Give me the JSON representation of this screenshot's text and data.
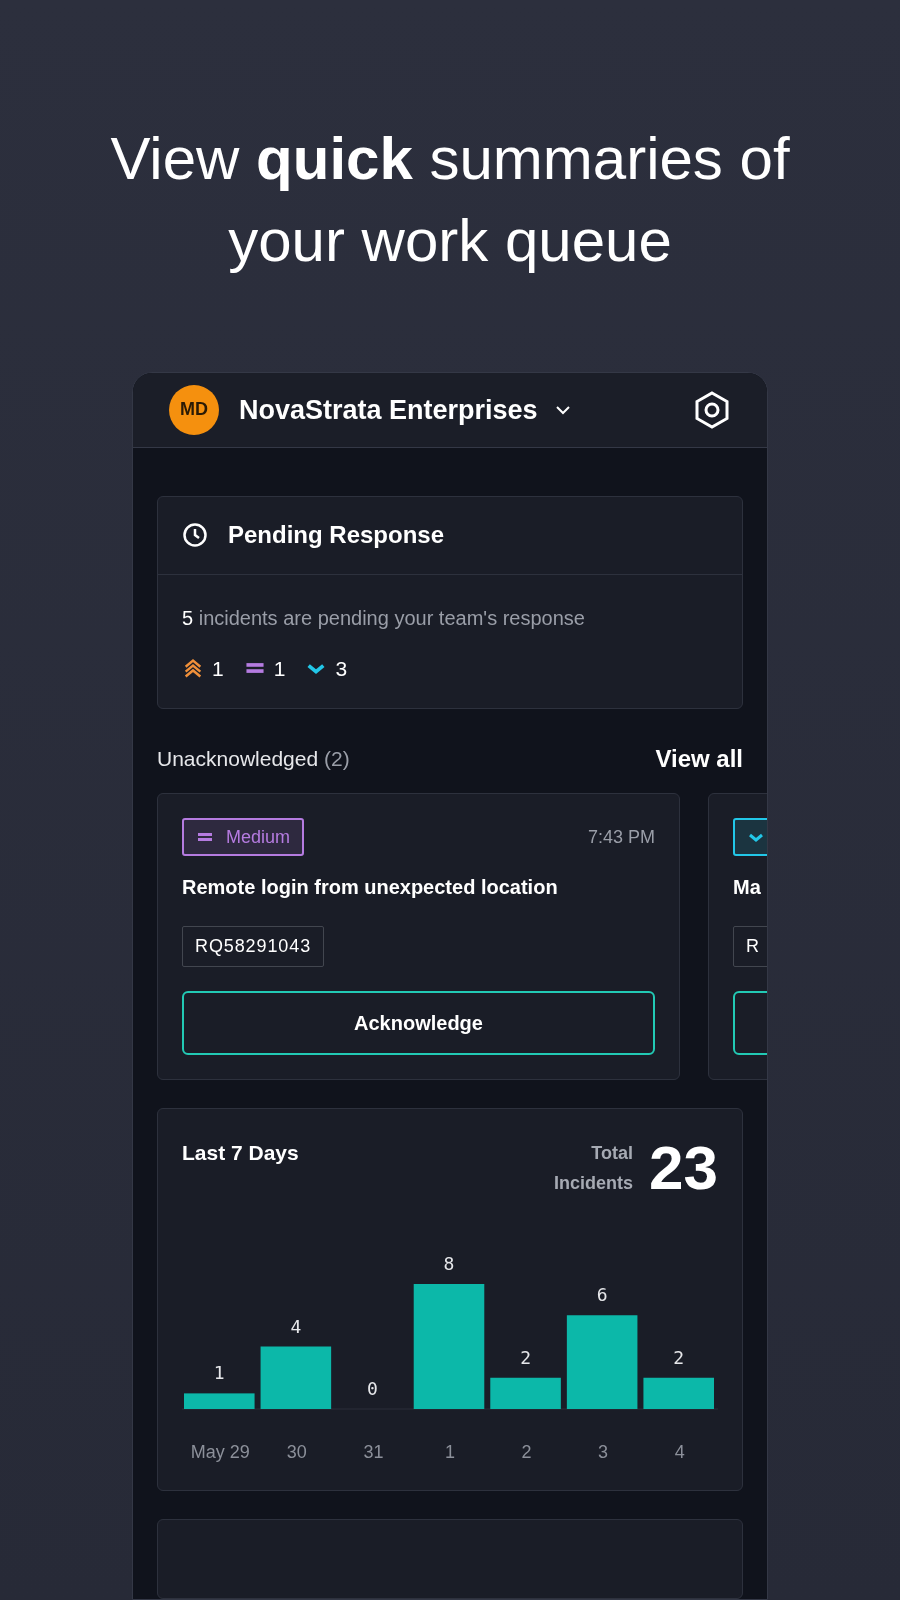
{
  "headline": "View **quick** summaries of your work queue",
  "header": {
    "avatar": "MD",
    "org": "NovaStrata Enterprises"
  },
  "pending": {
    "title": "Pending Response",
    "count": "5",
    "text": "incidents are pending your team's response",
    "priorities": [
      {
        "kind": "high",
        "count": "1"
      },
      {
        "kind": "medium",
        "count": "1"
      },
      {
        "kind": "low",
        "count": "3"
      }
    ]
  },
  "unacknowledged": {
    "label": "Unacknowledged",
    "count": "(2)",
    "view_all": "View all",
    "cards": [
      {
        "kind": "medium",
        "badge": "Medium",
        "time": "7:43 PM",
        "title": "Remote login from unexpected location",
        "ref": "RQ58291043",
        "action": "Acknowledge"
      },
      {
        "kind": "low",
        "title": "Ma",
        "ref": "R"
      }
    ]
  },
  "last7": {
    "title": "Last 7 Days",
    "total_label": "Total Incidents",
    "total": "23",
    "chart_data": {
      "type": "bar",
      "categories": [
        "May 29",
        "30",
        "31",
        "1",
        "2",
        "3",
        "4"
      ],
      "values": [
        1,
        4,
        0,
        8,
        2,
        6,
        2
      ],
      "data_labels": true
    }
  }
}
